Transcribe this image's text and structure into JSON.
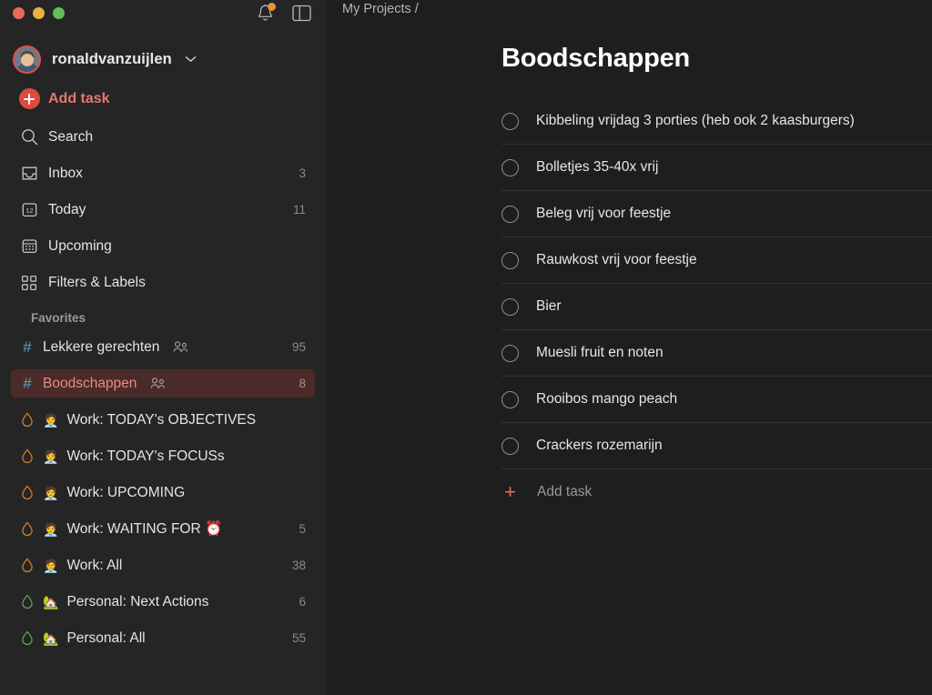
{
  "window": {
    "controls": [
      "close",
      "minimize",
      "maximize"
    ],
    "notifications_icon": "bell-icon",
    "panel_toggle_icon": "sidebar-panel-icon",
    "has_notification_badge": true
  },
  "account": {
    "username": "ronaldvanzuijlen",
    "dropdown_icon": "chevron-down-icon",
    "avatar_icon": "user-avatar"
  },
  "sidebar": {
    "add_task_label": "Add task",
    "nav": [
      {
        "label": "Search",
        "icon": "search-icon",
        "count": ""
      },
      {
        "label": "Inbox",
        "icon": "inbox-icon",
        "count": "3"
      },
      {
        "label": "Today",
        "icon": "calendar-12-icon",
        "count": "11"
      },
      {
        "label": "Upcoming",
        "icon": "upcoming-calendar-icon",
        "count": ""
      },
      {
        "label": "Filters & Labels",
        "icon": "filters-labels-icon",
        "count": ""
      }
    ],
    "favorites_title": "Favorites",
    "favorites": [
      {
        "label": "Lekkere gerechten",
        "icon": "hash-icon",
        "emoji": "",
        "shared": true,
        "count": "95",
        "active": false,
        "drop": ""
      },
      {
        "label": "Boodschappen",
        "icon": "hash-icon",
        "emoji": "",
        "shared": true,
        "count": "8",
        "active": true,
        "drop": ""
      },
      {
        "label": "Work: TODAY's OBJECTIVES",
        "icon": "filter-drop-icon",
        "emoji": "🧑‍💼",
        "shared": false,
        "count": "",
        "active": false,
        "drop": "orange"
      },
      {
        "label": "Work: TODAY's FOCUSs",
        "icon": "filter-drop-icon",
        "emoji": "🧑‍💼",
        "shared": false,
        "count": "",
        "active": false,
        "drop": "orange"
      },
      {
        "label": "Work: UPCOMING",
        "icon": "filter-drop-icon",
        "emoji": "🧑‍💼",
        "shared": false,
        "count": "",
        "active": false,
        "drop": "orange"
      },
      {
        "label": "Work: WAITING FOR ⏰",
        "icon": "filter-drop-icon",
        "emoji": "🧑‍💼",
        "shared": false,
        "count": "5",
        "active": false,
        "drop": "orange"
      },
      {
        "label": "Work: All",
        "icon": "filter-drop-icon",
        "emoji": "🧑‍💼",
        "shared": false,
        "count": "38",
        "active": false,
        "drop": "orange"
      },
      {
        "label": "Personal: Next Actions",
        "icon": "filter-drop-icon",
        "emoji": "🏡",
        "shared": false,
        "count": "6",
        "active": false,
        "drop": "green"
      },
      {
        "label": "Personal: All",
        "icon": "filter-drop-icon",
        "emoji": "🏡",
        "shared": false,
        "count": "55",
        "active": false,
        "drop": "green"
      }
    ]
  },
  "main": {
    "breadcrumb": "My Projects /",
    "title": "Boodschappen",
    "tasks": [
      {
        "text": "Kibbeling vrijdag 3 porties (heb ook 2 kaasburgers)"
      },
      {
        "text": "Bolletjes 35-40x vrij"
      },
      {
        "text": "Beleg vrij voor feestje"
      },
      {
        "text": "Rauwkost vrij voor feestje"
      },
      {
        "text": "Bier"
      },
      {
        "text": "Muesli fruit en noten"
      },
      {
        "text": "Rooibos mango peach"
      },
      {
        "text": "Crackers rozemarijn"
      }
    ],
    "add_task_label": "Add task"
  },
  "colors": {
    "accent_red": "#dd4b3e",
    "active_bg": "#4a2b2a",
    "active_text": "#e58d80",
    "hash_blue": "#5da7c9",
    "sidebar_bg": "#252525",
    "main_bg": "#1e1e1e",
    "notification_orange": "#e8913c"
  }
}
